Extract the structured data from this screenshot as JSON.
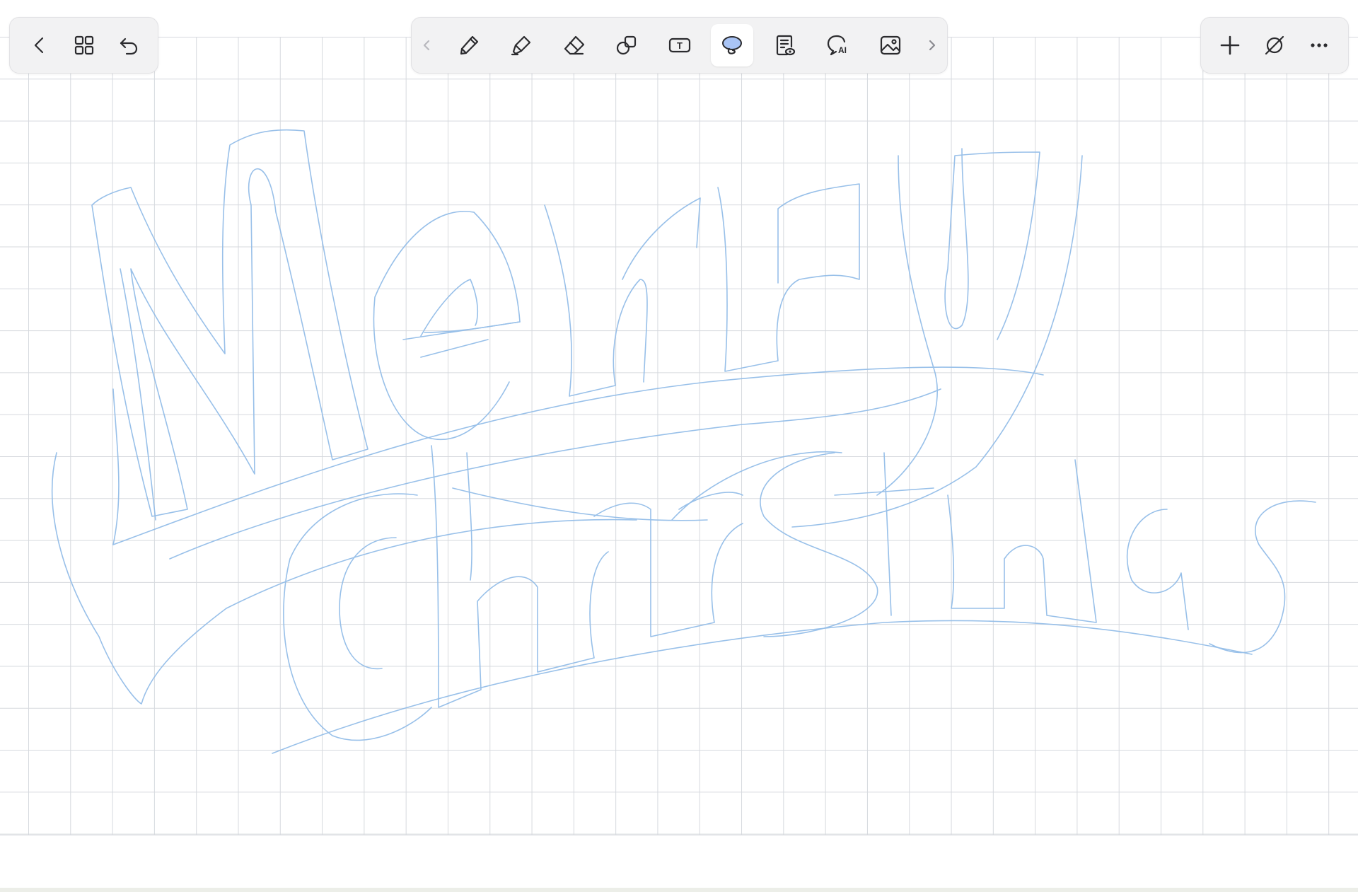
{
  "app": {
    "canvas": {
      "paper": "grid",
      "background": "#ffffff",
      "grid_color": "#d6d9de"
    },
    "ink": {
      "color": "#93bde8"
    },
    "accent": "#a9c4f5"
  },
  "toolbar_left": {
    "items": [
      {
        "icon": "chevron-left-icon",
        "action": "back"
      },
      {
        "icon": "grid-view-icon",
        "action": "pages"
      },
      {
        "icon": "undo-icon",
        "action": "undo"
      }
    ]
  },
  "toolbar_center": {
    "items": [
      {
        "icon": "chevron-left-icon",
        "state": "disabled"
      },
      {
        "icon": "pen-icon"
      },
      {
        "icon": "highlighter-icon"
      },
      {
        "icon": "eraser-icon"
      },
      {
        "icon": "shapes-icon"
      },
      {
        "icon": "text-box-icon"
      },
      {
        "icon": "lasso-icon",
        "state": "active"
      },
      {
        "icon": "document-review-icon"
      },
      {
        "icon": "ai-chat-icon"
      },
      {
        "icon": "image-icon"
      },
      {
        "icon": "chevron-right-icon"
      }
    ],
    "ai_badge": "AI",
    "text_badge": "T"
  },
  "toolbar_right": {
    "items": [
      {
        "icon": "plus-icon",
        "action": "add-page"
      },
      {
        "icon": "pen-disabled-icon",
        "action": "toggle-pen"
      },
      {
        "icon": "more-icon",
        "action": "more"
      }
    ]
  }
}
